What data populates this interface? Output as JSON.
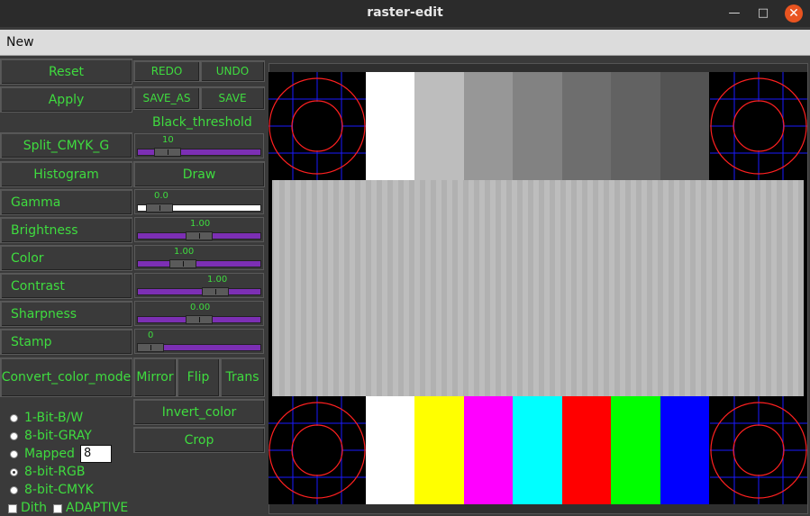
{
  "window": {
    "title": "raster-edit",
    "minimize": "—",
    "maximize": "□",
    "close": "✕"
  },
  "menu": {
    "new": "New"
  },
  "buttons": {
    "reset": "Reset",
    "redo": "REDO",
    "undo": "UNDO",
    "apply": "Apply",
    "save_as": "SAVE_AS",
    "save": "SAVE",
    "split_cmyk": "Split_CMYK_G",
    "histogram": "Histogram",
    "draw": "Draw",
    "convert": "Convert_color_mode",
    "mirror": "Mirror",
    "flip": "Flip",
    "trans": "Trans",
    "invert": "Invert_color",
    "crop": "Crop"
  },
  "black_threshold": {
    "label": "Black_threshold",
    "value": "10"
  },
  "adjustments": [
    {
      "label": "Gamma",
      "value": "0.0"
    },
    {
      "label": "Brightness",
      "value": "1.00"
    },
    {
      "label": "Color",
      "value": "1.00"
    },
    {
      "label": "Contrast",
      "value": "1.00"
    },
    {
      "label": "Sharpness",
      "value": "0.00"
    },
    {
      "label": "Stamp",
      "value": "0"
    }
  ],
  "modes": {
    "options": [
      "1-Bit-B/W",
      "8-bit-GRAY",
      "Mapped",
      "8-bit-RGB",
      "8-bit-CMYK"
    ],
    "selected": "8-bit-RGB",
    "mapped_value": "8",
    "dith": "Dith",
    "adaptive": "ADAPTIVE"
  },
  "colors": {
    "accent_text": "#3fdc3f",
    "slider_trough": "#7c2fb4",
    "background": "#3a3a3a"
  }
}
